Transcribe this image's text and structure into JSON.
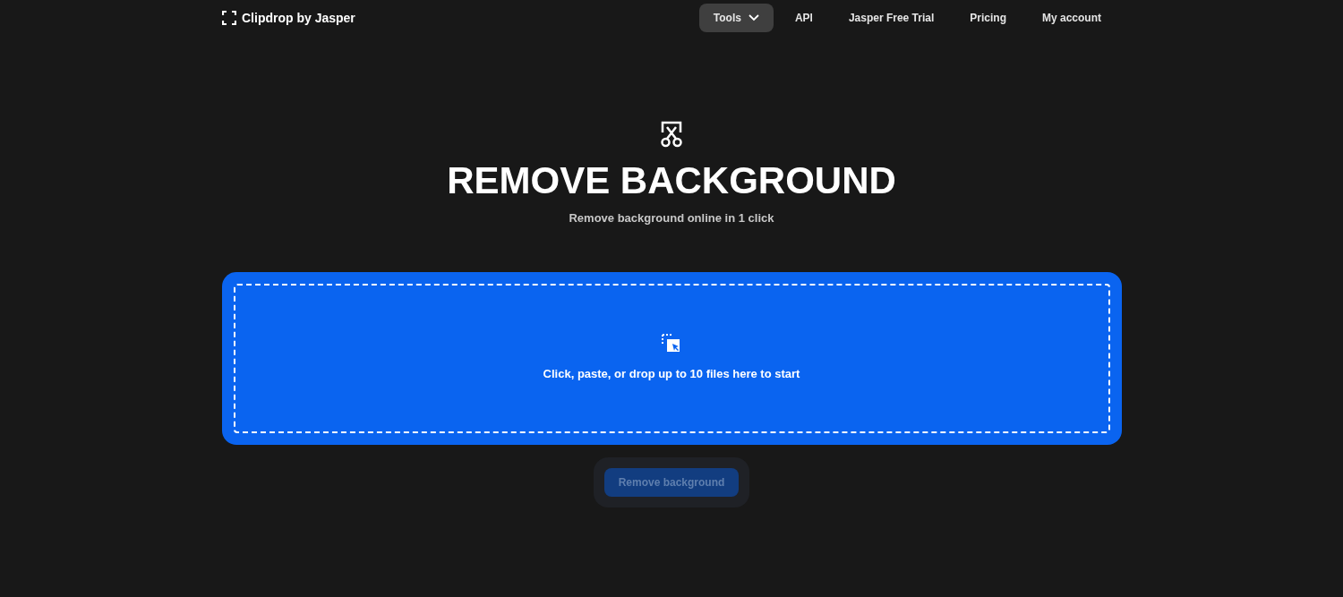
{
  "brand": {
    "name": "Clipdrop by Jasper"
  },
  "nav": [
    {
      "label": "Tools",
      "selected": true,
      "kind": "dropdown"
    },
    {
      "label": "API",
      "selected": false,
      "kind": "link"
    },
    {
      "label": "Jasper Free Trial",
      "selected": false,
      "kind": "link"
    },
    {
      "label": "Pricing",
      "selected": false,
      "kind": "link"
    },
    {
      "label": "My account",
      "selected": false,
      "kind": "link"
    }
  ],
  "hero": {
    "title": "REMOVE BACKGROUND",
    "subtitle": "Remove background online in 1 click"
  },
  "dropzone": {
    "prompt": "Click, paste, or drop up to 10 files here to start"
  },
  "action": {
    "label": "Remove background",
    "disabled": true
  }
}
